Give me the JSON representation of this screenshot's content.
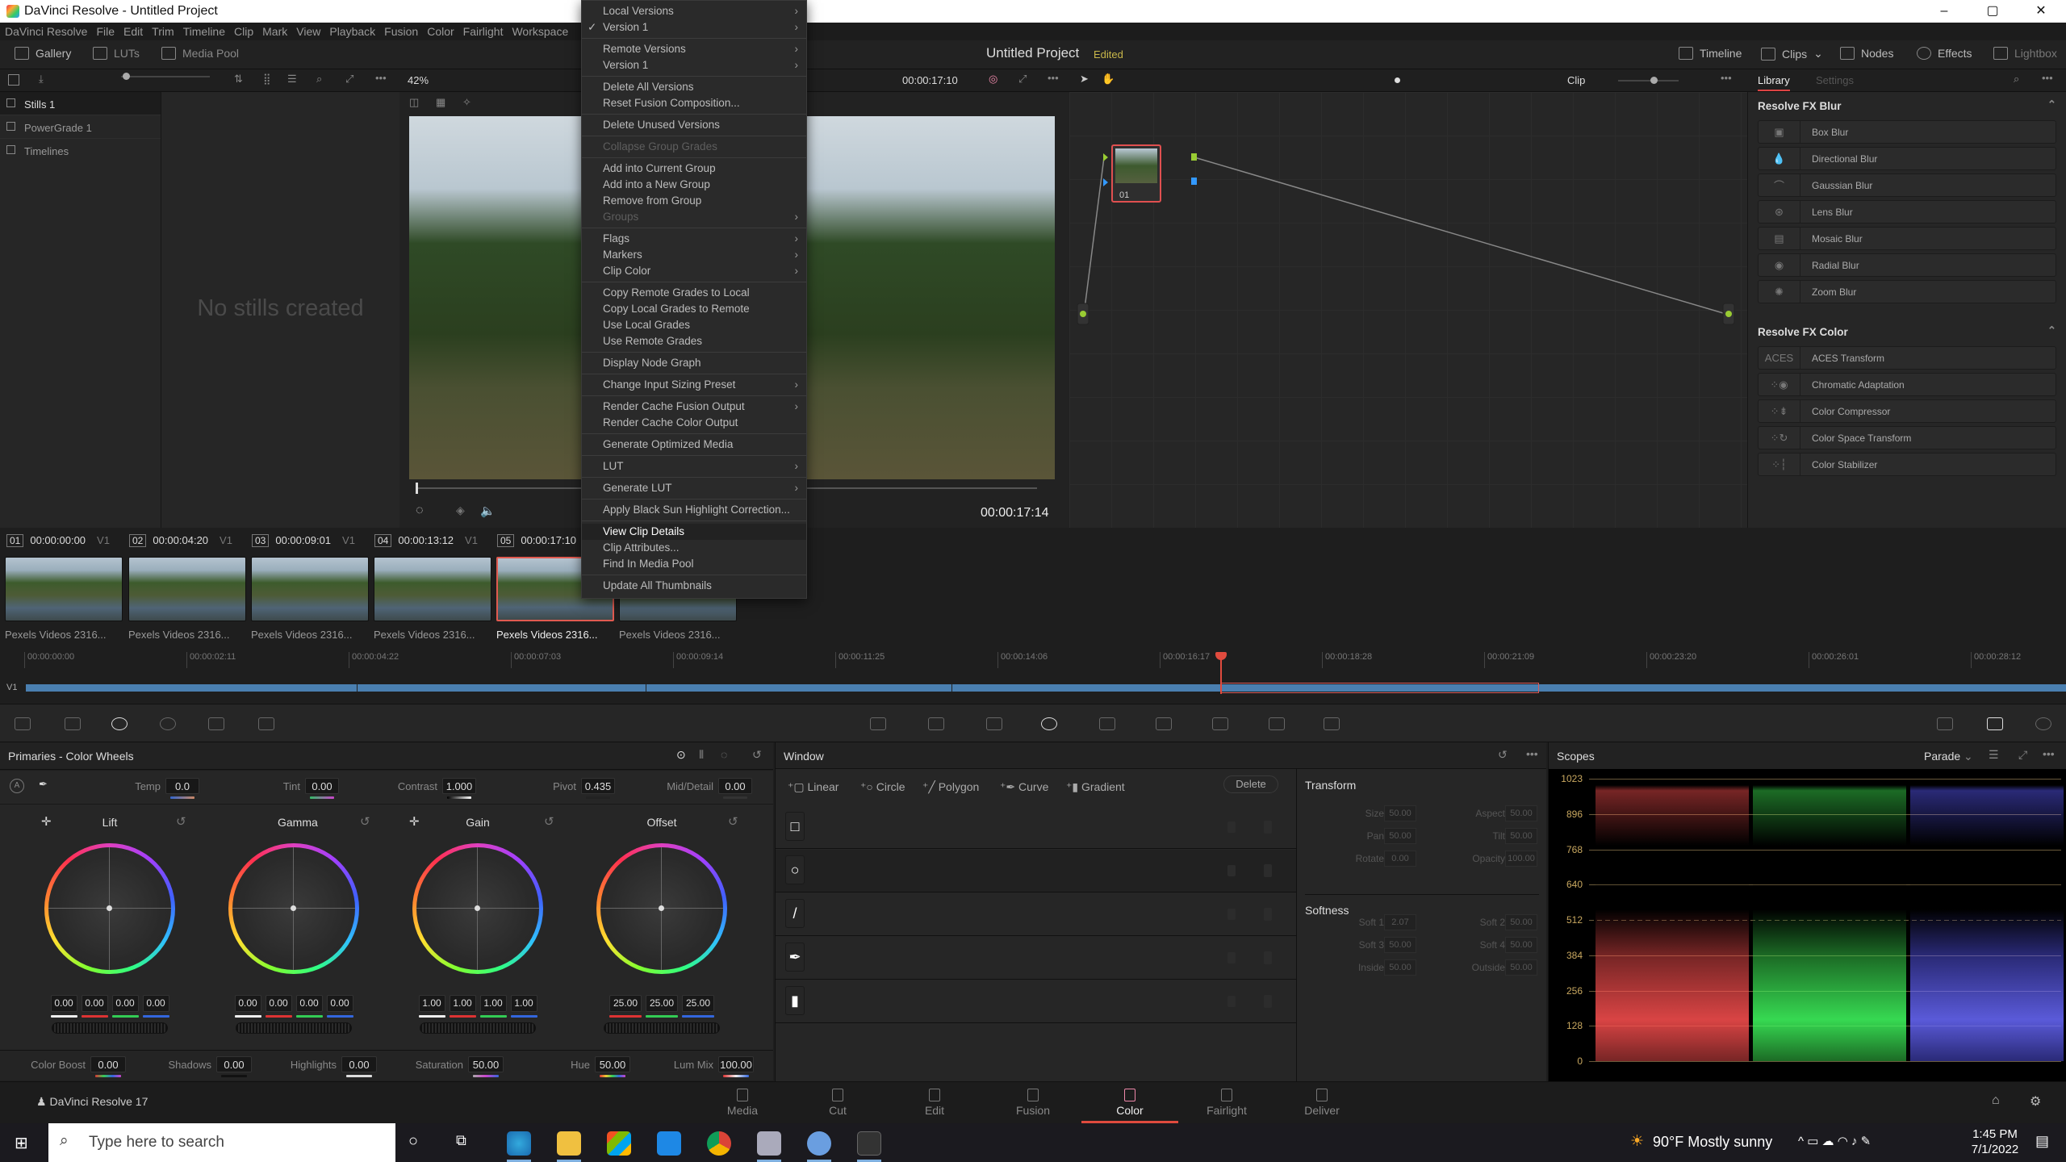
{
  "window": {
    "title": "DaVinci Resolve - Untitled Project",
    "controls": [
      "–",
      "▢",
      "✕"
    ]
  },
  "menubar": [
    "DaVinci Resolve",
    "File",
    "Edit",
    "Trim",
    "Timeline",
    "Clip",
    "Mark",
    "View",
    "Playback",
    "Fusion",
    "Color",
    "Fairlight",
    "Workspace"
  ],
  "modebar": {
    "left": [
      "Gallery",
      "LUTs",
      "Media Pool"
    ],
    "project": "Untitled Project",
    "status": "Edited",
    "right": [
      "Timeline",
      "Clips",
      "Nodes",
      "Effects",
      "Lightbox"
    ]
  },
  "toolbar": {
    "zoom": "42%",
    "timecode": "00:00:17:10",
    "node_mode": "Clip",
    "lib_tabs": [
      "Library",
      "Settings"
    ]
  },
  "gallery": {
    "items": [
      "Stills 1",
      "PowerGrade 1",
      "Timelines"
    ],
    "empty_text": "No stills created"
  },
  "viewer": {
    "timecode": "00:00:17:14"
  },
  "context_menu": [
    {
      "label": "Local Versions",
      "sub": true
    },
    {
      "label": "Version 1",
      "sub": true,
      "checked": true
    },
    {
      "sep": true
    },
    {
      "label": "Remote Versions",
      "sub": true
    },
    {
      "label": "Version 1",
      "sub": true
    },
    {
      "sep": true
    },
    {
      "label": "Delete All Versions"
    },
    {
      "label": "Reset Fusion Composition..."
    },
    {
      "sep": true
    },
    {
      "label": "Delete Unused Versions"
    },
    {
      "sep": true
    },
    {
      "label": "Collapse Group Grades",
      "disabled": true
    },
    {
      "sep": true
    },
    {
      "label": "Add into Current Group"
    },
    {
      "label": "Add into a New Group"
    },
    {
      "label": "Remove from Group"
    },
    {
      "label": "Groups",
      "sub": true,
      "disabled": true
    },
    {
      "sep": true
    },
    {
      "label": "Flags",
      "sub": true
    },
    {
      "label": "Markers",
      "sub": true
    },
    {
      "label": "Clip Color",
      "sub": true
    },
    {
      "sep": true
    },
    {
      "label": "Copy Remote Grades to Local"
    },
    {
      "label": "Copy Local Grades to Remote"
    },
    {
      "label": "Use Local Grades"
    },
    {
      "label": "Use Remote Grades"
    },
    {
      "sep": true
    },
    {
      "label": "Display Node Graph"
    },
    {
      "sep": true
    },
    {
      "label": "Change Input Sizing Preset",
      "sub": true
    },
    {
      "sep": true
    },
    {
      "label": "Render Cache Fusion Output",
      "sub": true
    },
    {
      "label": "Render Cache Color Output"
    },
    {
      "sep": true
    },
    {
      "label": "Generate Optimized Media"
    },
    {
      "sep": true
    },
    {
      "label": "LUT",
      "sub": true
    },
    {
      "sep": true
    },
    {
      "label": "Generate LUT",
      "sub": true
    },
    {
      "sep": true
    },
    {
      "label": "Apply Black Sun Highlight Correction..."
    },
    {
      "sep": true
    },
    {
      "label": "View Clip Details",
      "highlighted": true
    },
    {
      "label": "Clip Attributes..."
    },
    {
      "label": "Find In Media Pool"
    },
    {
      "sep": true
    },
    {
      "label": "Update All Thumbnails"
    }
  ],
  "nodes": {
    "node_label": "01"
  },
  "library": {
    "sections": [
      {
        "title": "Resolve FX Blur",
        "items": [
          "Box Blur",
          "Directional Blur",
          "Gaussian Blur",
          "Lens Blur",
          "Mosaic Blur",
          "Radial Blur",
          "Zoom Blur"
        ]
      },
      {
        "title": "Resolve FX Color",
        "items": [
          "ACES Transform",
          "Chromatic Adaptation",
          "Color Compressor",
          "Color Space Transform",
          "Color Stabilizer"
        ]
      }
    ]
  },
  "clips": [
    {
      "num": "01",
      "tc": "00:00:00:00",
      "track": "V1",
      "name": "Pexels Videos 2316..."
    },
    {
      "num": "02",
      "tc": "00:00:04:20",
      "track": "V1",
      "name": "Pexels Videos 2316..."
    },
    {
      "num": "03",
      "tc": "00:00:09:01",
      "track": "V1",
      "name": "Pexels Videos 2316..."
    },
    {
      "num": "04",
      "tc": "00:00:13:12",
      "track": "V1",
      "name": "Pexels Videos 2316..."
    },
    {
      "num": "05",
      "tc": "00:00:17:10",
      "track": "V1",
      "name": "Pexels Videos 2316...",
      "selected": true
    },
    {
      "num": "",
      "tc": "",
      "track": "",
      "name": "Pexels Videos 2316..."
    }
  ],
  "timeline": {
    "track": "V1",
    "ruler": [
      "00:00:00:00",
      "00:00:02:11",
      "00:00:04:22",
      "00:00:07:03",
      "00:00:09:14",
      "00:00:11:25",
      "00:00:14:06",
      "00:00:16:17",
      "00:00:18:28",
      "00:00:21:09",
      "00:00:23:20",
      "00:00:26:01",
      "00:00:28:12"
    ]
  },
  "primaries": {
    "title": "Primaries - Color Wheels",
    "adjust": [
      {
        "label": "Temp",
        "value": "0.0"
      },
      {
        "label": "Tint",
        "value": "0.00"
      },
      {
        "label": "Contrast",
        "value": "1.000"
      },
      {
        "label": "Pivot",
        "value": "0.435"
      },
      {
        "label": "Mid/Detail",
        "value": "0.00"
      }
    ],
    "wheels": [
      {
        "label": "Lift",
        "values": [
          "0.00",
          "0.00",
          "0.00",
          "0.00"
        ]
      },
      {
        "label": "Gamma",
        "values": [
          "0.00",
          "0.00",
          "0.00",
          "0.00"
        ]
      },
      {
        "label": "Gain",
        "values": [
          "1.00",
          "1.00",
          "1.00",
          "1.00"
        ]
      },
      {
        "label": "Offset",
        "values": [
          "25.00",
          "25.00",
          "25.00"
        ]
      }
    ],
    "bottom": [
      {
        "label": "Color Boost",
        "value": "0.00"
      },
      {
        "label": "Shadows",
        "value": "0.00"
      },
      {
        "label": "Highlights",
        "value": "0.00"
      },
      {
        "label": "Saturation",
        "value": "50.00"
      },
      {
        "label": "Hue",
        "value": "50.00"
      },
      {
        "label": "Lum Mix",
        "value": "100.00"
      }
    ]
  },
  "window_panel": {
    "title": "Window",
    "tools": [
      "Linear",
      "Circle",
      "Polygon",
      "Curve",
      "Gradient"
    ],
    "delete": "Delete",
    "shapes": [
      "□",
      "○",
      "/",
      "✒",
      "▮"
    ],
    "transform_title": "Transform",
    "transform": [
      {
        "label": "Size",
        "value": "50.00"
      },
      {
        "label": "Aspect",
        "value": "50.00"
      },
      {
        "label": "Pan",
        "value": "50.00"
      },
      {
        "label": "Tilt",
        "value": "50.00"
      },
      {
        "label": "Rotate",
        "value": "0.00"
      },
      {
        "label": "Opacity",
        "value": "100.00"
      }
    ],
    "softness_title": "Softness",
    "softness": [
      {
        "label": "Soft 1",
        "value": "2.07"
      },
      {
        "label": "Soft 2",
        "value": "50.00"
      },
      {
        "label": "Soft 3",
        "value": "50.00"
      },
      {
        "label": "Soft 4",
        "value": "50.00"
      },
      {
        "label": "Inside",
        "value": "50.00"
      },
      {
        "label": "Outside",
        "value": "50.00"
      }
    ]
  },
  "scopes": {
    "title": "Scopes",
    "mode": "Parade",
    "scale": [
      "1023",
      "896",
      "768",
      "640",
      "512",
      "384",
      "256",
      "128",
      "0"
    ]
  },
  "pages": {
    "app": "DaVinci Resolve 17",
    "items": [
      "Media",
      "Cut",
      "Edit",
      "Fusion",
      "Color",
      "Fairlight",
      "Deliver"
    ],
    "active": "Color"
  },
  "taskbar": {
    "search_placeholder": "Type here to search",
    "weather": "90°F  Mostly sunny",
    "time": "1:45 PM",
    "date": "7/1/2022"
  }
}
